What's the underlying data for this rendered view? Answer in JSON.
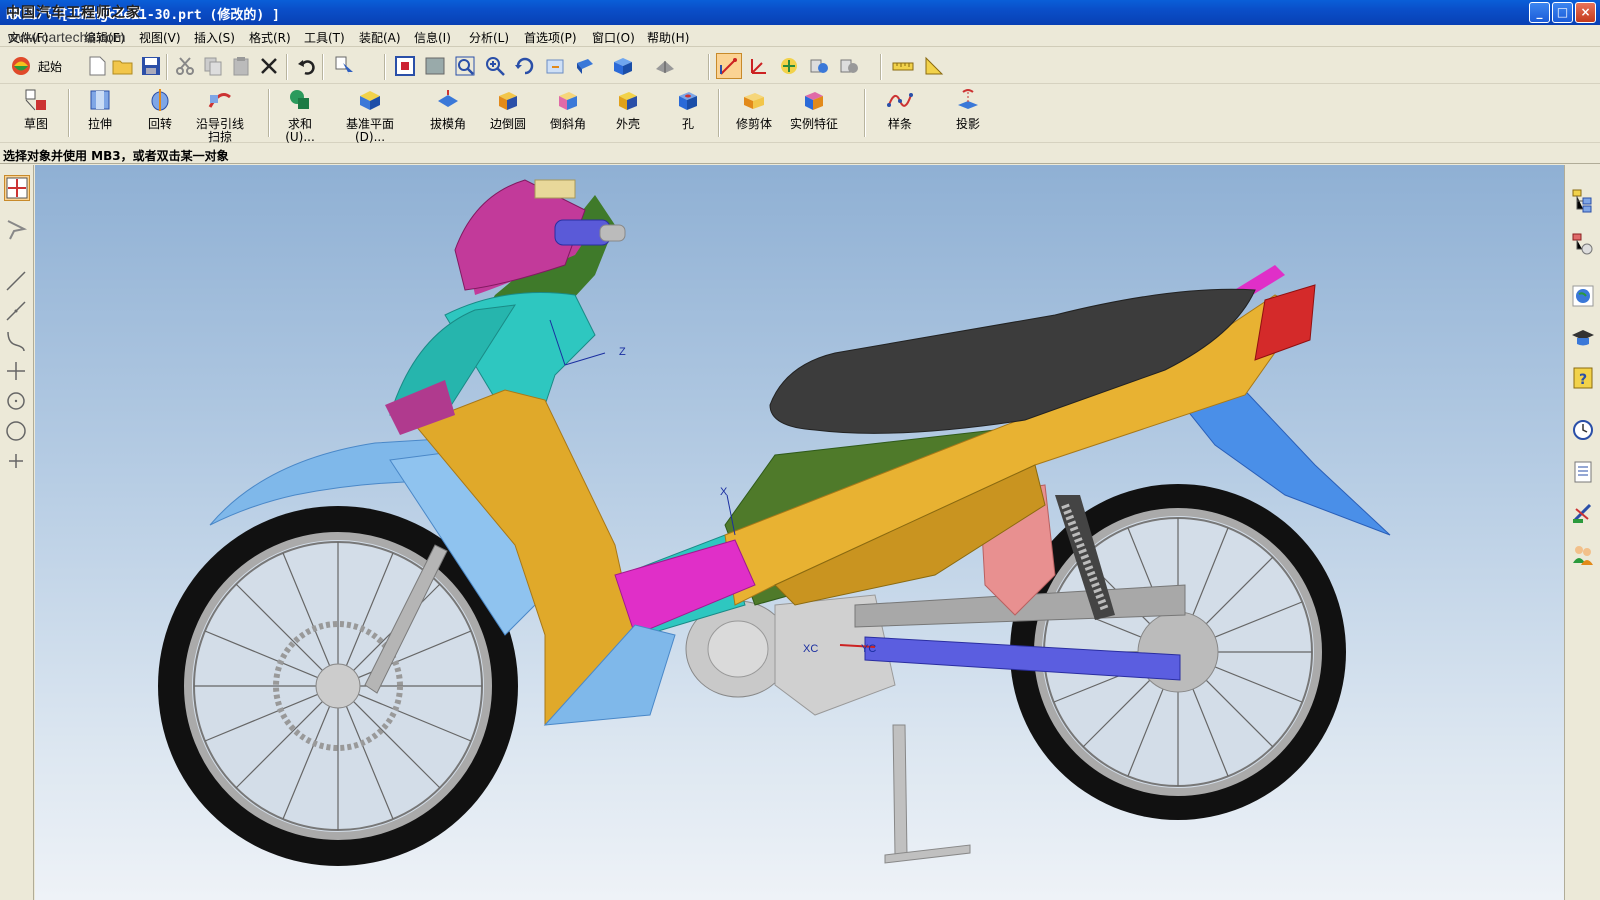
{
  "window": {
    "title": "NX 1 - [zhengche11-30.prt  (修改的) ]",
    "watermark": "中国汽车工程师之家",
    "url_watermark": "www.cartech8.com",
    "controls": [
      "_",
      "□",
      "×"
    ]
  },
  "menu": {
    "items": [
      {
        "label": "文件(F)"
      },
      {
        "label": "编辑(E)"
      },
      {
        "label": "视图(V)"
      },
      {
        "label": "插入(S)"
      },
      {
        "label": "格式(R)"
      },
      {
        "label": "工具(T)"
      },
      {
        "label": "装配(A)"
      },
      {
        "label": "信息(I)"
      },
      {
        "label": "分析(L)"
      },
      {
        "label": "首选项(P)"
      },
      {
        "label": "窗口(O)"
      },
      {
        "label": "帮助(H)"
      }
    ],
    "mdi_controls": "- 🗗 ×"
  },
  "toolbar1": {
    "start_label": "起始"
  },
  "features": [
    {
      "label": "草图"
    },
    {
      "label": "拉伸"
    },
    {
      "label": "回转"
    },
    {
      "label": "沿导引线\n扫掠"
    },
    {
      "label": "求和\n(U)..."
    },
    {
      "label": "基准平面\n(D)..."
    },
    {
      "label": "拔模角"
    },
    {
      "label": "边倒圆"
    },
    {
      "label": "倒斜角"
    },
    {
      "label": "外壳"
    },
    {
      "label": "孔"
    },
    {
      "label": "修剪体"
    },
    {
      "label": "实例特征"
    },
    {
      "label": "样条"
    },
    {
      "label": "投影"
    }
  ],
  "status": {
    "message": "选择对象并使用 MB3，或者双击某一对象"
  },
  "viewport": {
    "axes": {
      "z": "Z",
      "x": "X",
      "xc": "XC",
      "yc": "YC"
    },
    "model": "motorcycle"
  },
  "colors": {
    "titlebar": "#0a4ec8",
    "chrome": "#ece9d8",
    "body_yellow": "#e0a92a",
    "body_cyan": "#2ec7c0",
    "body_green": "#4f7a2a",
    "body_magenta": "#e02fc8",
    "body_lightblue": "#7fb8ea",
    "seat": "#3c3c3c"
  }
}
